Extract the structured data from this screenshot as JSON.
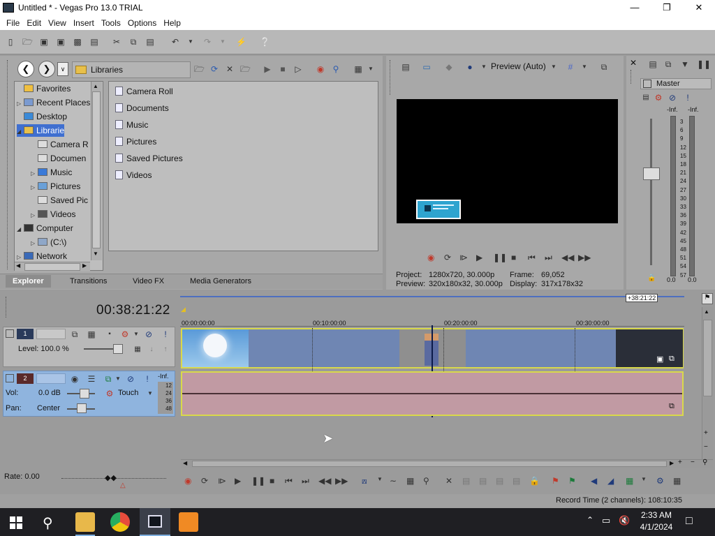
{
  "window": {
    "title": "Untitled * - Vegas Pro 13.0 TRIAL"
  },
  "menu": [
    "File",
    "Edit",
    "View",
    "Insert",
    "Tools",
    "Options",
    "Help"
  ],
  "explorer": {
    "location": "Libraries",
    "tree": [
      {
        "label": "Favorites",
        "level": 1,
        "expander": ""
      },
      {
        "label": "Recent Places",
        "level": 1,
        "expander": "▷"
      },
      {
        "label": "Desktop",
        "level": 1,
        "expander": ""
      },
      {
        "label": "Libraries",
        "level": 1,
        "expander": "◢",
        "selected": true
      },
      {
        "label": "Camera R",
        "level": 2,
        "expander": ""
      },
      {
        "label": "Documen",
        "level": 2,
        "expander": ""
      },
      {
        "label": "Music",
        "level": 2,
        "expander": "▷"
      },
      {
        "label": "Pictures",
        "level": 2,
        "expander": "▷"
      },
      {
        "label": "Saved Pic",
        "level": 2,
        "expander": ""
      },
      {
        "label": "Videos",
        "level": 2,
        "expander": "▷"
      },
      {
        "label": "Computer",
        "level": 1,
        "expander": "◢"
      },
      {
        "label": "(C:\\)",
        "level": 2,
        "expander": "▷"
      },
      {
        "label": "Network",
        "level": 1,
        "expander": "▷"
      }
    ],
    "files": [
      "Camera Roll",
      "Documents",
      "Music",
      "Pictures",
      "Saved Pictures",
      "Videos"
    ],
    "tabs": [
      "Explorer",
      "Transitions",
      "Video FX",
      "Media Generators"
    ]
  },
  "preview": {
    "mode": "Preview (Auto)",
    "project_label": "Project:",
    "project_value": "1280x720, 30.000p",
    "preview_label": "Preview:",
    "preview_value": "320x180x32, 30.000p",
    "frame_label": "Frame:",
    "frame_value": "69,052",
    "display_label": "Display:",
    "display_value": "317x178x32"
  },
  "master": {
    "title": "Master",
    "left_inf": "-Inf.",
    "right_inf": "-Inf.",
    "scale": [
      "3",
      "6",
      "9",
      "12",
      "15",
      "18",
      "21",
      "24",
      "27",
      "30",
      "33",
      "36",
      "39",
      "42",
      "45",
      "48",
      "51",
      "54",
      "57"
    ],
    "left_value": "0.0",
    "right_value": "0.0"
  },
  "timeline": {
    "timecode": "00:38:21:22",
    "end_marker": "+38:21:22",
    "ruler": [
      "00:00:00:00",
      "00:10:00:00",
      "00:20:00:00",
      "00:30:00:00"
    ],
    "track1": {
      "number": "1",
      "level_label": "Level: 100.0 %"
    },
    "track2": {
      "number": "2",
      "vol_label": "Vol:",
      "vol_value": "0.0 dB",
      "pan_label": "Pan:",
      "pan_value": "Center",
      "touch": "Touch",
      "inf": "-Inf.",
      "scale": [
        "12",
        "24",
        "36",
        "48"
      ]
    },
    "rate": "Rate: 0.00"
  },
  "status": {
    "record_time": "Record Time (2 channels): 108:10:35"
  },
  "taskbar": {
    "time": "2:33 AM",
    "date": "4/1/2024"
  }
}
